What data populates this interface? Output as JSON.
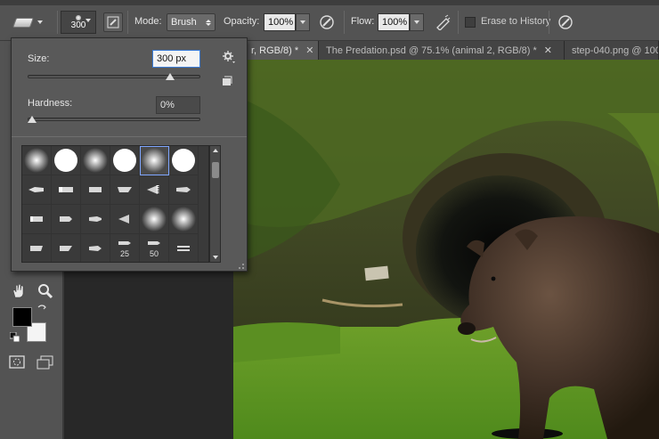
{
  "options_bar": {
    "brush_size_label": "300",
    "mode_label": "Mode:",
    "mode_value": "Brush",
    "opacity_label": "Opacity:",
    "opacity_value": "100%",
    "flow_label": "Flow:",
    "flow_value": "100%",
    "erase_history_label": "Erase to History",
    "erase_history_checked": false
  },
  "tabs": [
    {
      "label": "r, RGB/8) *",
      "active": true
    },
    {
      "label": "The Predation.psd @ 75.1% (animal 2, RGB/8) *",
      "active": false
    },
    {
      "label": "step-040.png @ 100",
      "active": false
    }
  ],
  "brush_panel": {
    "size_label": "Size:",
    "size_value": "300 px",
    "size_fraction": 0.82,
    "hardness_label": "Hardness:",
    "hardness_value": "0%",
    "hardness_fraction": 0.0,
    "tip_numbers": [
      "25",
      "50"
    ]
  },
  "colors": {
    "foreground": "#000000",
    "background": "#ffffff",
    "panel": "#595959",
    "accent": "#3a7bd5"
  },
  "icons": {
    "tool": "eraser-icon",
    "airbrush": "airbrush-icon",
    "pressure": "pressure-icon",
    "panel_menu": "gear-icon",
    "new_preset": "new-preset-icon",
    "hand": "hand-icon",
    "zoom": "zoom-icon",
    "swap": "swap-colors-icon",
    "reset": "default-colors-icon",
    "quick_mask": "quick-mask-icon",
    "screen_mode": "screen-mode-icon"
  }
}
